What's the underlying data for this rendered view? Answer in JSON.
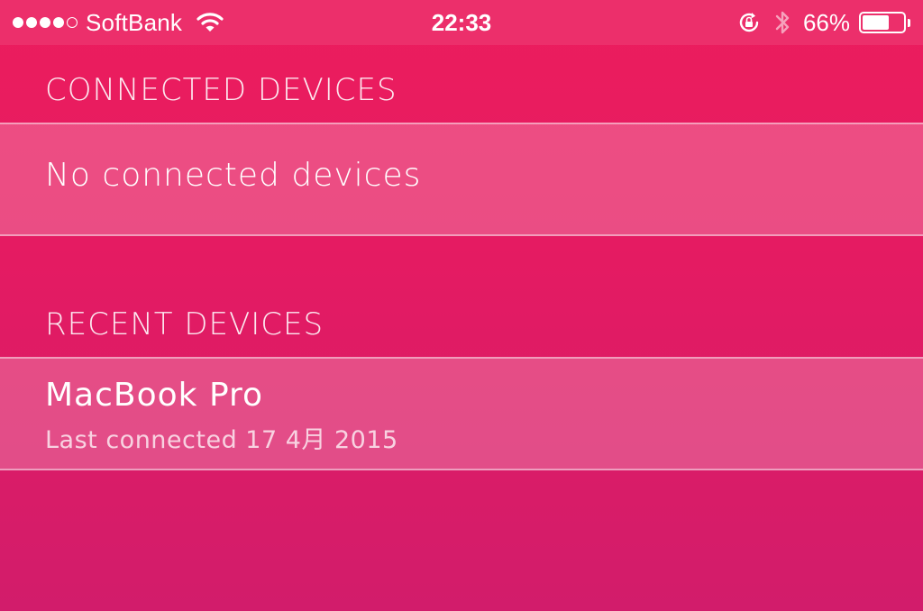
{
  "status_bar": {
    "signal_filled": 4,
    "signal_total": 5,
    "carrier": "SoftBank",
    "time": "22:33",
    "battery_percent": "66%",
    "battery_level": 0.66,
    "icons": [
      "wifi-icon",
      "rotation-lock-icon",
      "bluetooth-icon",
      "battery-icon"
    ]
  },
  "connected": {
    "header": "CONNECTED DEVICES",
    "empty_text": "No connected devices"
  },
  "recent": {
    "header": "RECENT DEVICES",
    "devices": [
      {
        "name": "MacBook Pro",
        "last_connected": "Last connected 17 4月 2015"
      }
    ]
  },
  "colors": {
    "status_bar": "#ec2f6b",
    "background_top": "#ec1d5d",
    "background_bottom": "#d21c6b",
    "text": "#ffffff"
  }
}
